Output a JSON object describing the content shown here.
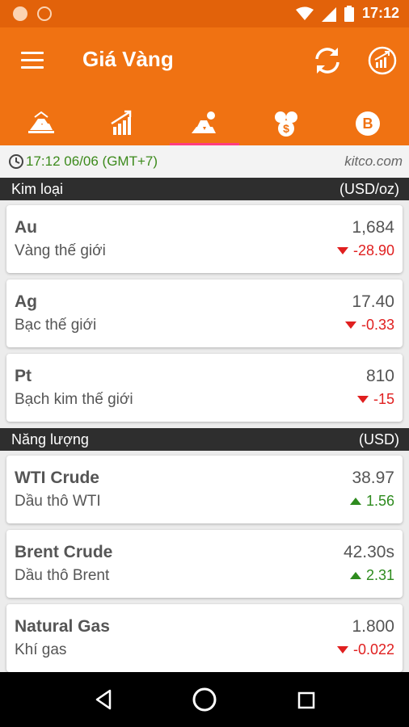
{
  "status_bar": {
    "time": "17:12",
    "icons": [
      "notification-dot-icon",
      "running-icon",
      "wifi-icon",
      "signal-icon",
      "battery-icon"
    ]
  },
  "app_bar": {
    "title": "Giá Vàng",
    "menu_icon": "menu-icon",
    "actions": [
      "refresh-icon",
      "trend-chart-icon"
    ]
  },
  "tabs": [
    {
      "icon": "gold-bars-sun-icon",
      "active": false
    },
    {
      "icon": "growth-chart-icon",
      "active": false
    },
    {
      "icon": "metal-bars-icon",
      "active": true
    },
    {
      "icon": "currency-exchange-icon",
      "active": false
    },
    {
      "icon": "bitcoin-icon",
      "active": false
    }
  ],
  "timestamp": {
    "text": "17:12 06/06 (GMT+7)",
    "source": "kitco.com"
  },
  "sections": [
    {
      "title": "Kim loại",
      "unit": "(USD/oz)",
      "items": [
        {
          "code": "Au",
          "name": "Vàng thế giới",
          "price": "1,684",
          "change": "-28.90",
          "direction": "down"
        },
        {
          "code": "Ag",
          "name": "Bạc thế giới",
          "price": "17.40",
          "change": "-0.33",
          "direction": "down"
        },
        {
          "code": "Pt",
          "name": "Bạch kim thế giới",
          "price": "810",
          "change": "-15",
          "direction": "down"
        }
      ]
    },
    {
      "title": "Năng lượng",
      "unit": "(USD)",
      "items": [
        {
          "code": "WTI Crude",
          "name": "Dầu thô WTI",
          "price": "38.97",
          "change": "1.56",
          "direction": "up"
        },
        {
          "code": "Brent Crude",
          "name": "Dầu thô Brent",
          "price": "42.30s",
          "change": "2.31",
          "direction": "up"
        },
        {
          "code": "Natural Gas",
          "name": "Khí gas",
          "price": "1.800",
          "change": "-0.022",
          "direction": "down"
        }
      ]
    }
  ],
  "colors": {
    "status_bar": "#e2620a",
    "app_bar": "#f07212",
    "tab_indicator": "#ff3d7f",
    "down": "#e01f1f",
    "up": "#2e8b1e",
    "timestamp": "#3c8a1c"
  },
  "nav_bar": {
    "icons": [
      "back-icon",
      "home-icon",
      "recent-apps-icon"
    ]
  }
}
